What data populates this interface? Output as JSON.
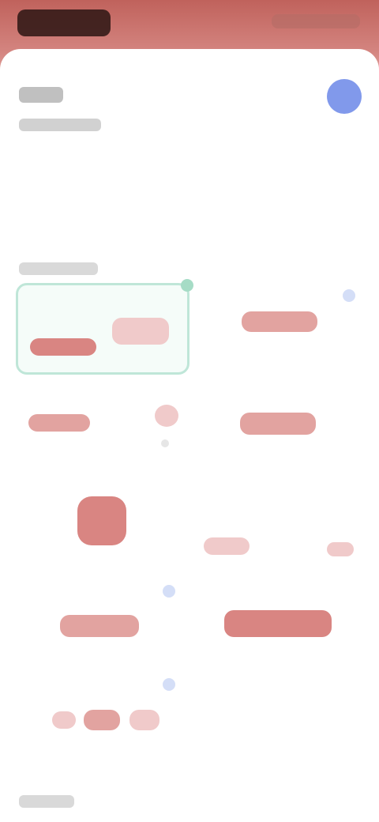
{
  "status_bar": {
    "time": "",
    "icons": ""
  },
  "card": {
    "title": "",
    "subtitle": "",
    "section_1": "",
    "section_2": ""
  },
  "items": [
    {
      "label": ""
    },
    {
      "label": ""
    },
    {
      "label": ""
    },
    {
      "label": ""
    },
    {
      "label": ""
    },
    {
      "label": ""
    },
    {
      "label": ""
    },
    {
      "label": ""
    },
    {
      "label": ""
    },
    {
      "label": ""
    },
    {
      "label": ""
    }
  ],
  "colors": {
    "header": "#c0625c",
    "accent_blue": "#6b87e8",
    "item_red": "#e2a3a0",
    "highlight_green": "#bfe6d8"
  }
}
